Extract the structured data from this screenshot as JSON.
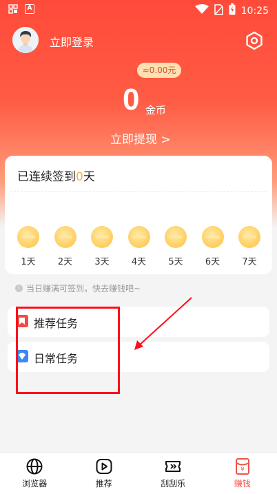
{
  "status_bar": {
    "left_icons": [
      "gallery-icon",
      "a-icon"
    ],
    "a_glyph": "A",
    "right_icons": [
      "wifi-icon",
      "no-sim-icon",
      "battery-icon"
    ],
    "time": "10:25"
  },
  "header": {
    "login_label": "立即登录",
    "settings_icon": "hexagon-settings-icon"
  },
  "balance": {
    "cash": "≈0.00元",
    "coins": "0",
    "coin_unit": "金币",
    "withdraw_label": "立即提现 >"
  },
  "checkin": {
    "title_prefix": "已连续签到",
    "days": "0",
    "title_suffix": "天",
    "day_labels": [
      "1天",
      "2天",
      "3天",
      "4天",
      "5天",
      "6天",
      "7天"
    ]
  },
  "hint": {
    "text": "当日赚满可签到，快去赚钱吧~"
  },
  "tasks": [
    {
      "label": "推荐任务",
      "icon": "bookmark-icon",
      "color": "#f04b47"
    },
    {
      "label": "日常任务",
      "icon": "diamond-icon",
      "color": "#3d86f5"
    }
  ],
  "annotation": {
    "color": "#ff0d1a"
  },
  "bottom_nav": [
    {
      "label": "浏览器",
      "icon": "globe-icon"
    },
    {
      "label": "推荐",
      "icon": "play-icon"
    },
    {
      "label": "刮刮乐",
      "icon": "ticket-icon"
    },
    {
      "label": "赚钱",
      "icon": "red-envelope-icon",
      "active": true
    }
  ],
  "colors": {
    "accent": "#ff4a3a",
    "coin_highlight": "#f2b33d",
    "active_nav": "#f2504a"
  }
}
